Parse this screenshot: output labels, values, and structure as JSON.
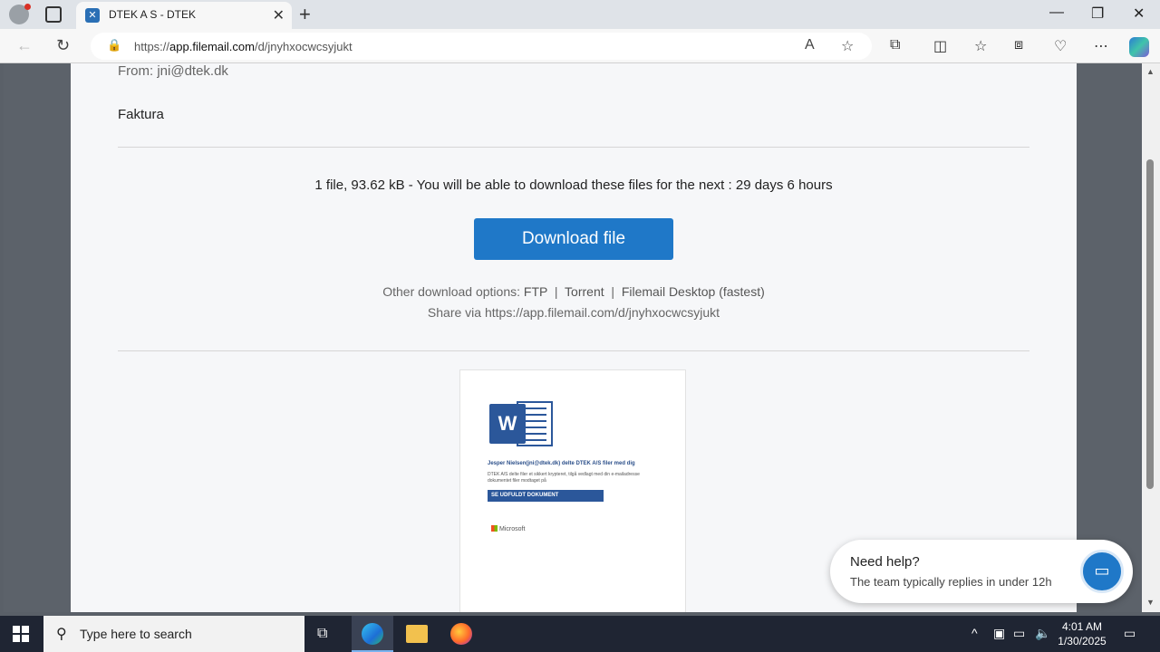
{
  "browser": {
    "tab_title": "DTEK A S - DTEK",
    "url_prefix": "https://",
    "url_domain": "app.filemail.com",
    "url_path": "/d/jnyhxocwcsyjukt"
  },
  "email": {
    "from": "From: jni@dtek.dk",
    "subject": "Faktura"
  },
  "download": {
    "info": "1 file, 93.62 kB - You will be able to download these files for the next : 29 days 6 hours",
    "button_label": "Download file",
    "other_prefix": "Other download options:",
    "opt_ftp": "FTP",
    "opt_torrent": "Torrent",
    "opt_desktop": "Filemail Desktop (fastest)",
    "share_prefix": "Share via",
    "share_url": "https://app.filemail.com/d/jnyhxocwcsyjukt"
  },
  "preview": {
    "title": "Jesper Nielsen(jni@dtek.dk) delte DTEK A/S filer med dig",
    "body": "DTEK A/S delte filer et sikkert krypteret, tilgå vedlagt med din e-mailadresse dokumentet filer modtaget på",
    "button": "SE UDFULDT DOKUMENT",
    "brand": "Microsoft"
  },
  "chat": {
    "heading": "Need help?",
    "subtitle": "The team typically replies in under 12h"
  },
  "taskbar": {
    "search_placeholder": "Type here to search",
    "time": "4:01 AM",
    "date": "1/30/2025"
  },
  "colors": {
    "accent": "#1f78c8",
    "word_blue": "#2b579a"
  }
}
